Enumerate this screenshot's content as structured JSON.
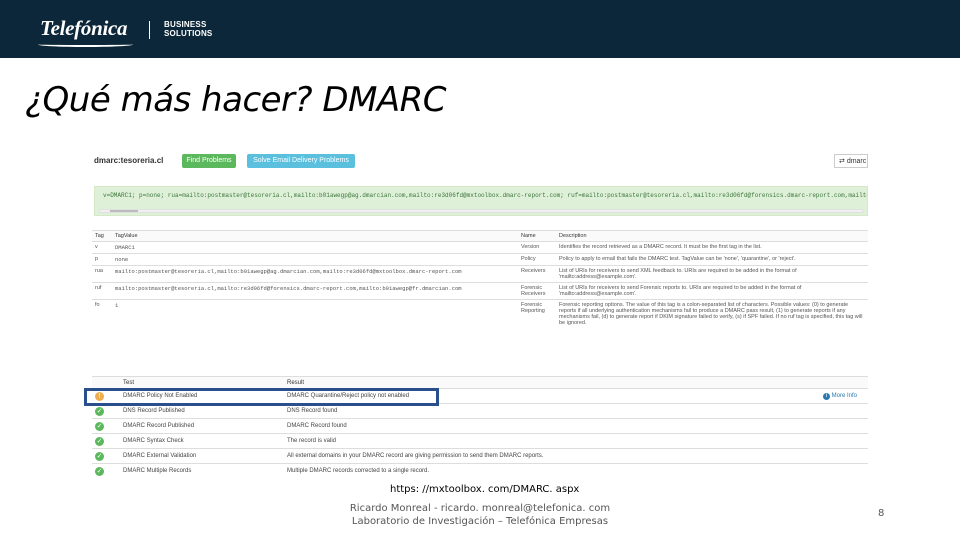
{
  "header": {
    "logo_text": "Telefónica",
    "business_line1": "BUSINESS",
    "business_line2": "SOLUTIONS"
  },
  "slide": {
    "title": "¿Qué más hacer? DMARC",
    "url": "https: //mxtoolbox. com/DMARC. aspx",
    "footer_line1": "Ricardo Monreal - ricardo. monreal@telefonica. com",
    "footer_line2": "Laboratorio de Investigación – Telefónica Empresas",
    "page_number": "8"
  },
  "screenshot": {
    "domain": "dmarc:tesoreria.cl",
    "btn_find": "Find Problems",
    "btn_solve": "Solve Email Delivery Problems",
    "btn_dmarc": "dmarc",
    "record": "v=DMARC1; p=none; rua=mailto:postmaster@tesoreria.cl,mailto:b01awegp@ag.dmarcian.com,mailto:re3d06fd@mxtoolbox.dmarc-report.com; ruf=mailto:postmaster@tesoreria.cl,mailto:re3d06fd@forensics.dmarc-report.com,mailto:b01a",
    "tag_headers": [
      "Tag",
      "TagValue",
      "Name",
      "Description"
    ],
    "tag_rows": [
      {
        "tag": "v",
        "value": "DMARC1",
        "name": "Version",
        "desc": "Identifies the record retrieved as a DMARC record. It must be the first tag in the list."
      },
      {
        "tag": "p",
        "value": "none",
        "name": "Policy",
        "desc": "Policy to apply to email that fails the DMARC test. TagValue can be 'none', 'quarantine', or 'reject'."
      },
      {
        "tag": "rua",
        "value": "mailto:postmaster@tesoreria.cl,mailto:b01awegp@ag.dmarcian.com,mailto:re3d06fd@mxtoolbox.dmarc-report.com",
        "name": "Receivers",
        "desc": "List of URIs for receivers to send XML feedback to. URIs are required to be added in the format of 'mailto:address@example.com'."
      },
      {
        "tag": "ruf",
        "value": "mailto:postmaster@tesoreria.cl,mailto:re3d06fd@forensics.dmarc-report.com,mailto:b01awegp@fr.dmarcian.com",
        "name": "Forensic Receivers",
        "desc": "List of URIs for receivers to send Forensic reports to. URIs are required to be added in the format of 'mailto:address@example.com'."
      },
      {
        "tag": "fo",
        "value": "1",
        "name": "Forensic Reporting",
        "desc": "Forensic reporting options. The value of this tag is a colon-separated list of characters. Possible values: (0) to generate reports if all underlying authentication mechanisms fail to produce a DMARC pass result, (1) to generate reports if any mechanisms fail, (d) to generate report if DKIM signature failed to verify, (s) if SPF failed. If no ruf tag is specified, this tag will be ignored."
      }
    ],
    "result_headers": [
      "Test",
      "Result"
    ],
    "result_rows": [
      {
        "test": "DMARC Policy Not Enabled",
        "result": "DMARC Quarantine/Reject policy not enabled",
        "status": "warning"
      },
      {
        "test": "DNS Record Published",
        "result": "DNS Record found",
        "status": "ok"
      },
      {
        "test": "DMARC Record Published",
        "result": "DMARC Record found",
        "status": "ok"
      },
      {
        "test": "DMARC Syntax Check",
        "result": "The record is valid",
        "status": "ok"
      },
      {
        "test": "DMARC External Validation",
        "result": "All external domains in your DMARC record are giving permission to send them DMARC reports.",
        "status": "ok"
      },
      {
        "test": "DMARC Multiple Records",
        "result": "Multiple DMARC records corrected to a single record.",
        "status": "ok"
      }
    ],
    "more_info": "More Info"
  },
  "colors": {
    "header_bg": "#0b2739",
    "green_button": "#5cb85c",
    "blue_button": "#5bc0de",
    "highlight_border": "#2b4f8c"
  }
}
